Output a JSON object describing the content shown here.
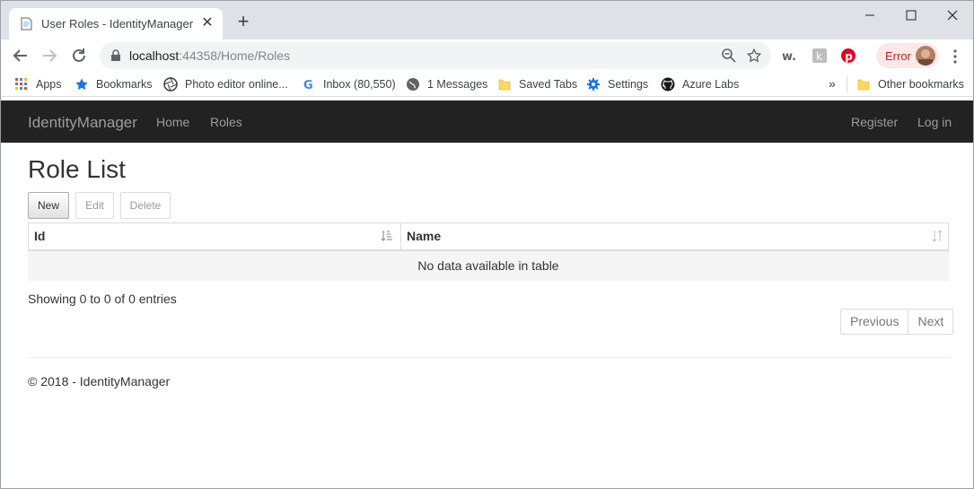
{
  "browser": {
    "tab_title": "User Roles - IdentityManager",
    "url_host": "localhost",
    "url_rest": ":44358/Home/Roles",
    "error_label": "Error"
  },
  "bookmarks": [
    {
      "label": "Apps",
      "icon": "apps-grid-icon"
    },
    {
      "label": "Bookmarks",
      "icon": "star-icon"
    },
    {
      "label": "Photo editor online...",
      "icon": "aperture-icon"
    },
    {
      "label": "Inbox (80,550)",
      "icon": "google-icon"
    },
    {
      "label": "1 Messages",
      "icon": "globe-icon"
    },
    {
      "label": "Saved Tabs",
      "icon": "folder-icon"
    },
    {
      "label": "Settings",
      "icon": "gear-icon"
    },
    {
      "label": "Azure Labs",
      "icon": "github-icon"
    }
  ],
  "other_bookmarks": "Other bookmarks",
  "navbar": {
    "brand": "IdentityManager",
    "links": [
      "Home",
      "Roles"
    ],
    "right_links": [
      "Register",
      "Log in"
    ]
  },
  "page": {
    "title": "Role List",
    "buttons": {
      "new": "New",
      "edit": "Edit",
      "delete": "Delete"
    },
    "table": {
      "columns": [
        "Id",
        "Name"
      ],
      "empty_message": "No data available in table"
    },
    "info": "Showing 0 to 0 of 0 entries",
    "pager": {
      "previous": "Previous",
      "next": "Next"
    },
    "footer": "© 2018 - IdentityManager"
  },
  "colors": {
    "navbar_bg": "#222222",
    "navbar_text": "#9d9d9d",
    "error_text": "#c5221f"
  }
}
